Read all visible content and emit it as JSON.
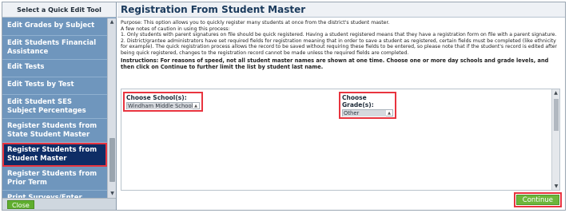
{
  "sidebar": {
    "header": "Select a Quick Edit Tool",
    "items": [
      {
        "label": "Edit Grades by Subject"
      },
      {
        "label": "Edit Students Financial Assistance"
      },
      {
        "label": "Edit Tests"
      },
      {
        "label": "Edit Tests by Test"
      },
      {
        "label": "Edit Student SES Subject Percentages"
      },
      {
        "label": "Register Students from State Student Master"
      },
      {
        "label": "Register Students from Student Master"
      },
      {
        "label": "Register Students from Prior Term"
      },
      {
        "label": "Print Surveys/Enter Responses"
      }
    ],
    "selected_index": 6,
    "close_label": "Close"
  },
  "main": {
    "title": "Registration From Student Master",
    "purpose": "Purpose: This option allows you to quickly register many students at once from the district's student master.",
    "notes_intro": "A few notes of caution in using this process:",
    "note1": "1. Only students with parent signatures on file should be quick registered. Having a student registered means that they have a registration form on file with a parent signature.",
    "note2": "2. District/grantee administrators have set required fields for registration meaning that in order to save a student as registered, certain fields must be completed (like ethnicity for example). The quick registration process allows the record to be saved without requiring these fields to be entered, so please note that if the student's record is edited after being quick registered, changes to the registration record cannot be made unless the required fields are completed.",
    "instructions": "Instructions: For reasons of speed, not all student master names are shown at one time. Choose one or more day schools and grade levels, and then click on Continue to further limit the list by student last name.",
    "school_label": "Choose School(s):",
    "school_value": "Windham Middle School",
    "grade_label": "Choose Grade(s):",
    "grade_value": "Other",
    "continue_label": "Continue"
  },
  "colors": {
    "sidebar_bg": "#6f96bd",
    "selected_bg": "#0e2d66",
    "highlight": "#e8343f",
    "button_green": "#6db63b"
  }
}
